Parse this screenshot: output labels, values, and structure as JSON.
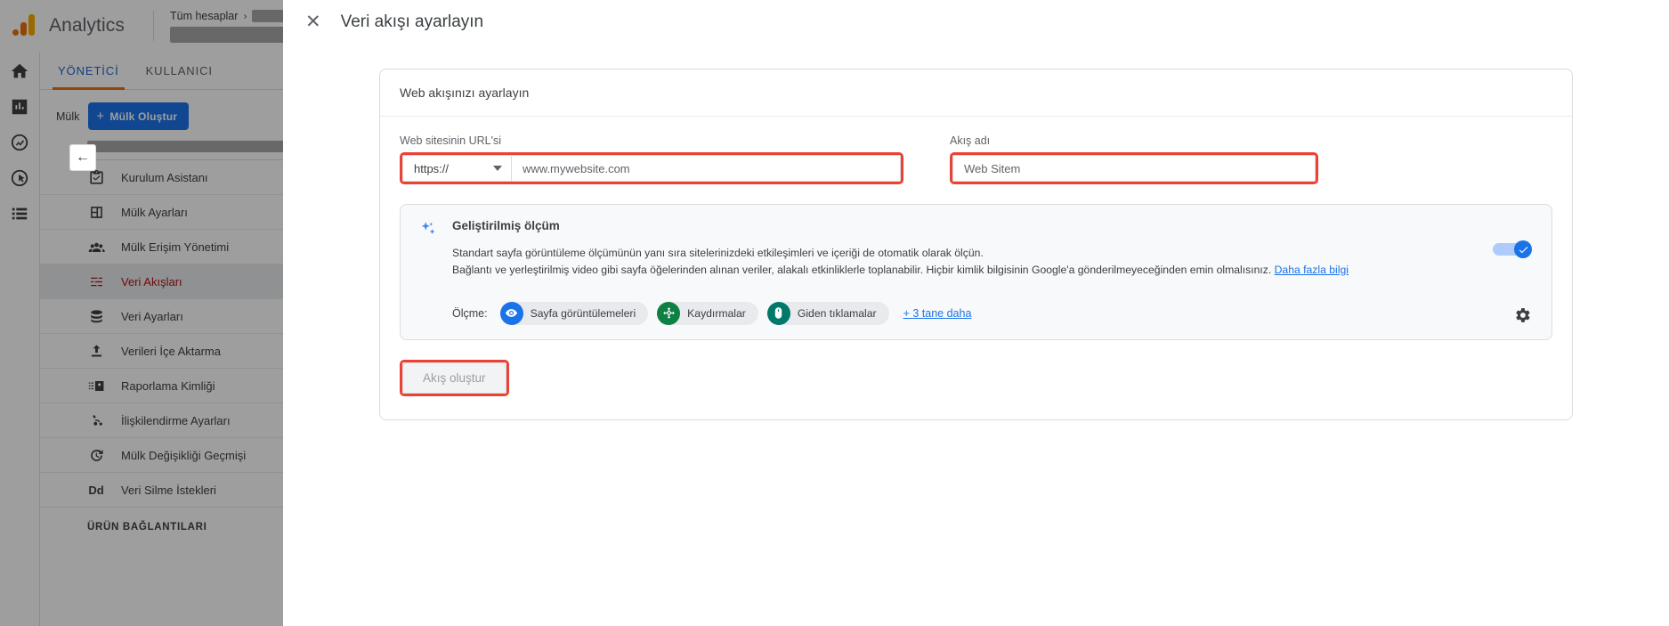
{
  "header": {
    "product": "Analytics",
    "breadcrumb_first": "Tüm hesaplar",
    "breadcrumb_chevron": "›"
  },
  "rail": {
    "items": [
      {
        "name": "home-icon",
        "label": "Ana Sayfa"
      },
      {
        "name": "reports-icon",
        "label": "Raporlar"
      },
      {
        "name": "explore-icon",
        "label": "Keşfet"
      },
      {
        "name": "advertising-icon",
        "label": "Reklamcılık"
      },
      {
        "name": "library-icon",
        "label": "Kitaplık"
      }
    ]
  },
  "admin": {
    "tabs": [
      {
        "label": "YÖNETİCİ",
        "active": true
      },
      {
        "label": "KULLANICI",
        "active": false
      }
    ],
    "property_label": "Mülk",
    "create_property_button": "Mülk Oluştur",
    "create_property_plus": "+",
    "collapse_arrow": "←",
    "nav_items": [
      {
        "label": "Kurulum Asistanı",
        "icon": "checklist-icon",
        "selected": false
      },
      {
        "label": "Mülk Ayarları",
        "icon": "layout-icon",
        "selected": false
      },
      {
        "label": "Mülk Erişim Yönetimi",
        "icon": "people-icon",
        "selected": false
      },
      {
        "label": "Veri Akışları",
        "icon": "data-streams-icon",
        "selected": true
      },
      {
        "label": "Veri Ayarları",
        "icon": "database-icon",
        "selected": false
      },
      {
        "label": "Verileri İçe Aktarma",
        "icon": "upload-icon",
        "selected": false
      },
      {
        "label": "Raporlama Kimliği",
        "icon": "reporting-identity-icon",
        "selected": false
      },
      {
        "label": "İlişkilendirme Ayarları",
        "icon": "attribution-icon",
        "selected": false
      },
      {
        "label": "Mülk Değişikliği Geçmişi",
        "icon": "history-icon",
        "selected": false
      },
      {
        "label": "Veri Silme İstekleri",
        "icon": "dd-letters-icon",
        "selected": false
      }
    ],
    "section_title": "ÜRÜN BAĞLANTILARI"
  },
  "modal": {
    "close_icon": "✕",
    "title": "Veri akışı ayarlayın",
    "card_header": "Web akışınızı ayarlayın",
    "url_field": {
      "label": "Web sitesinin URL'si",
      "protocol_value": "https://",
      "url_placeholder": "www.mywebsite.com",
      "url_value": ""
    },
    "name_field": {
      "label": "Akış adı",
      "placeholder": "Web Sitem",
      "value": ""
    },
    "enhanced": {
      "title": "Geliştirilmiş ölçüm",
      "desc_line1": "Standart sayfa görüntüleme ölçümünün yanı sıra sitelerinizdeki etkileşimleri ve içeriği de otomatik olarak ölçün.",
      "desc_line2": "Bağlantı ve yerleştirilmiş video gibi sayfa öğelerinden alınan veriler, alakalı etkinliklerle toplanabilir. Hiçbir kimlik bilgisinin Google'a gönderilmeyeceğinden emin olmalısınız.",
      "learn_more": "Daha fazla bilgi",
      "toggle_on": true,
      "measure_label": "Ölçme:",
      "chips": [
        {
          "label": "Sayfa görüntülemeleri",
          "icon": "eye-icon",
          "color": "#1a73e8"
        },
        {
          "label": "Kaydırmalar",
          "icon": "scroll-target-icon",
          "color": "#0f8043"
        },
        {
          "label": "Giden tıklamalar",
          "icon": "mouse-click-icon",
          "color": "#00796b"
        }
      ],
      "more_chips_link": "+ 3 tane daha",
      "settings_icon": "gear-icon"
    },
    "submit_button": "Akış oluştur"
  },
  "colors": {
    "accent_blue": "#1a73e8",
    "highlight_red": "#ea4335",
    "selected_red": "#b31412",
    "orange": "#e8710a"
  }
}
